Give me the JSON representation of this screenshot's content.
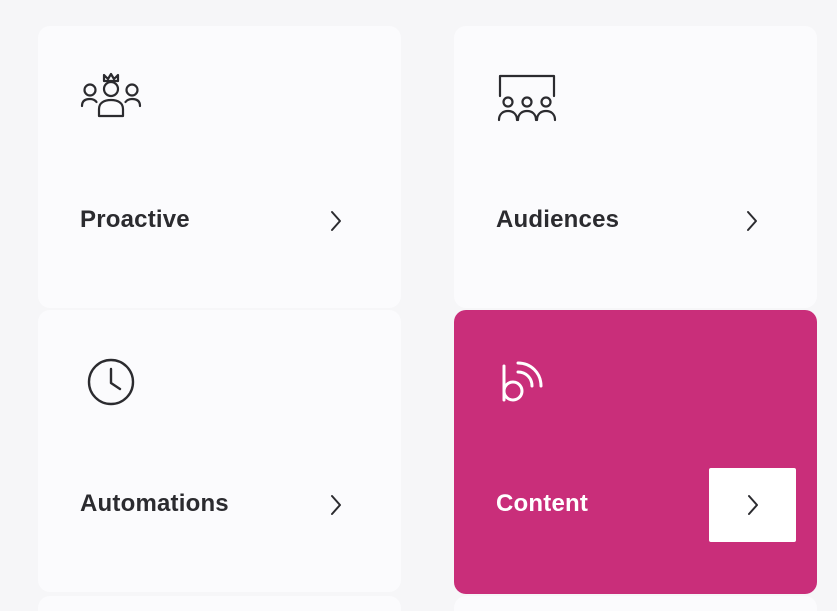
{
  "cards": [
    {
      "label": "Proactive",
      "icon": "team-crown-icon"
    },
    {
      "label": "Audiences",
      "icon": "audience-board-icon"
    },
    {
      "label": "Automations",
      "icon": "clock-icon"
    },
    {
      "label": "Content",
      "icon": "broadcast-b-icon",
      "selected": true
    }
  ],
  "colors": {
    "card_bg": "#fbfbfd",
    "page_bg": "#f6f6f8",
    "accent": "#c92e7a",
    "text": "#2b2b2f"
  }
}
